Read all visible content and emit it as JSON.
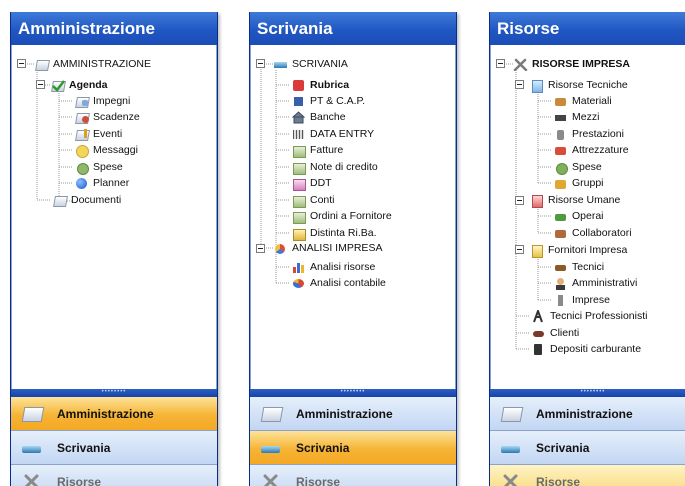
{
  "panels": [
    {
      "title": "Amministrazione",
      "tree": [
        {
          "label": "AMMINISTRAZIONE",
          "icon": "folder-doc-icon"
        },
        {
          "label": "Agenda",
          "icon": "agenda-check-icon"
        },
        {
          "label": "Impegni",
          "icon": "impegni-icon"
        },
        {
          "label": "Scadenze",
          "icon": "scadenze-icon"
        },
        {
          "label": "Eventi",
          "icon": "eventi-icon"
        },
        {
          "label": "Messaggi",
          "icon": "messaggi-icon"
        },
        {
          "label": "Spese",
          "icon": "spese-icon"
        },
        {
          "label": "Planner",
          "icon": "planner-icon"
        },
        {
          "label": "Documenti",
          "icon": "documenti-icon"
        }
      ]
    },
    {
      "title": "Scrivania",
      "tree": [
        {
          "label": "SCRIVANIA",
          "icon": "desk-icon"
        },
        {
          "label": "Rubrica",
          "icon": "rubrica-icon"
        },
        {
          "label": "PT & C.A.P.",
          "icon": "pt-cap-icon"
        },
        {
          "label": "Banche",
          "icon": "bank-icon"
        },
        {
          "label": "DATA ENTRY",
          "icon": "data-entry-icon"
        },
        {
          "label": "Fatture",
          "icon": "fatture-icon"
        },
        {
          "label": "Note di credito",
          "icon": "note-credito-icon"
        },
        {
          "label": "DDT",
          "icon": "ddt-icon"
        },
        {
          "label": "Conti",
          "icon": "conti-icon"
        },
        {
          "label": "Ordini a Fornitore",
          "icon": "ordini-icon"
        },
        {
          "label": "Distinta Ri.Ba.",
          "icon": "riba-icon"
        },
        {
          "label": "ANALISI IMPRESA",
          "icon": "analisi-impresa-icon"
        },
        {
          "label": "Analisi risorse",
          "icon": "analisi-risorse-icon"
        },
        {
          "label": "Analisi contabile",
          "icon": "analisi-contabile-icon"
        }
      ]
    },
    {
      "title": "Risorse",
      "tree": [
        {
          "label": "RISORSE IMPRESA",
          "icon": "tools-icon"
        },
        {
          "label": "Risorse Tecniche",
          "icon": "risorse-tecniche-icon"
        },
        {
          "label": "Materiali",
          "icon": "materiali-icon"
        },
        {
          "label": "Mezzi",
          "icon": "mezzi-icon"
        },
        {
          "label": "Prestazioni",
          "icon": "prestazioni-icon"
        },
        {
          "label": "Attrezzature",
          "icon": "attrezzature-icon"
        },
        {
          "label": "Spese",
          "icon": "spese-icon"
        },
        {
          "label": "Gruppi",
          "icon": "gruppi-icon"
        },
        {
          "label": "Risorse Umane",
          "icon": "risorse-umane-icon"
        },
        {
          "label": "Operai",
          "icon": "operai-icon"
        },
        {
          "label": "Collaboratori",
          "icon": "collaboratori-icon"
        },
        {
          "label": "Fornitori Impresa",
          "icon": "fornitori-icon"
        },
        {
          "label": "Tecnici",
          "icon": "tecnici-icon"
        },
        {
          "label": "Amministrativi",
          "icon": "amministrativi-icon"
        },
        {
          "label": "Imprese",
          "icon": "imprese-icon"
        },
        {
          "label": "Tecnici Professionisti",
          "icon": "tecnici-professionisti-icon"
        },
        {
          "label": "Clienti",
          "icon": "clienti-icon"
        },
        {
          "label": "Depositi carburante",
          "icon": "depositi-carburante-icon"
        }
      ]
    }
  ],
  "nav_buttons": [
    {
      "label": "Amministrazione",
      "icon": "amministrazione-icon"
    },
    {
      "label": "Scrivania",
      "icon": "scrivania-icon"
    },
    {
      "label": "Risorse",
      "icon": "risorse-icon"
    }
  ],
  "splitter_text": "••••••••",
  "colors": {
    "header": "#2157c2",
    "selected_nav": "#f6b436",
    "nav": "#c2d6f3"
  }
}
